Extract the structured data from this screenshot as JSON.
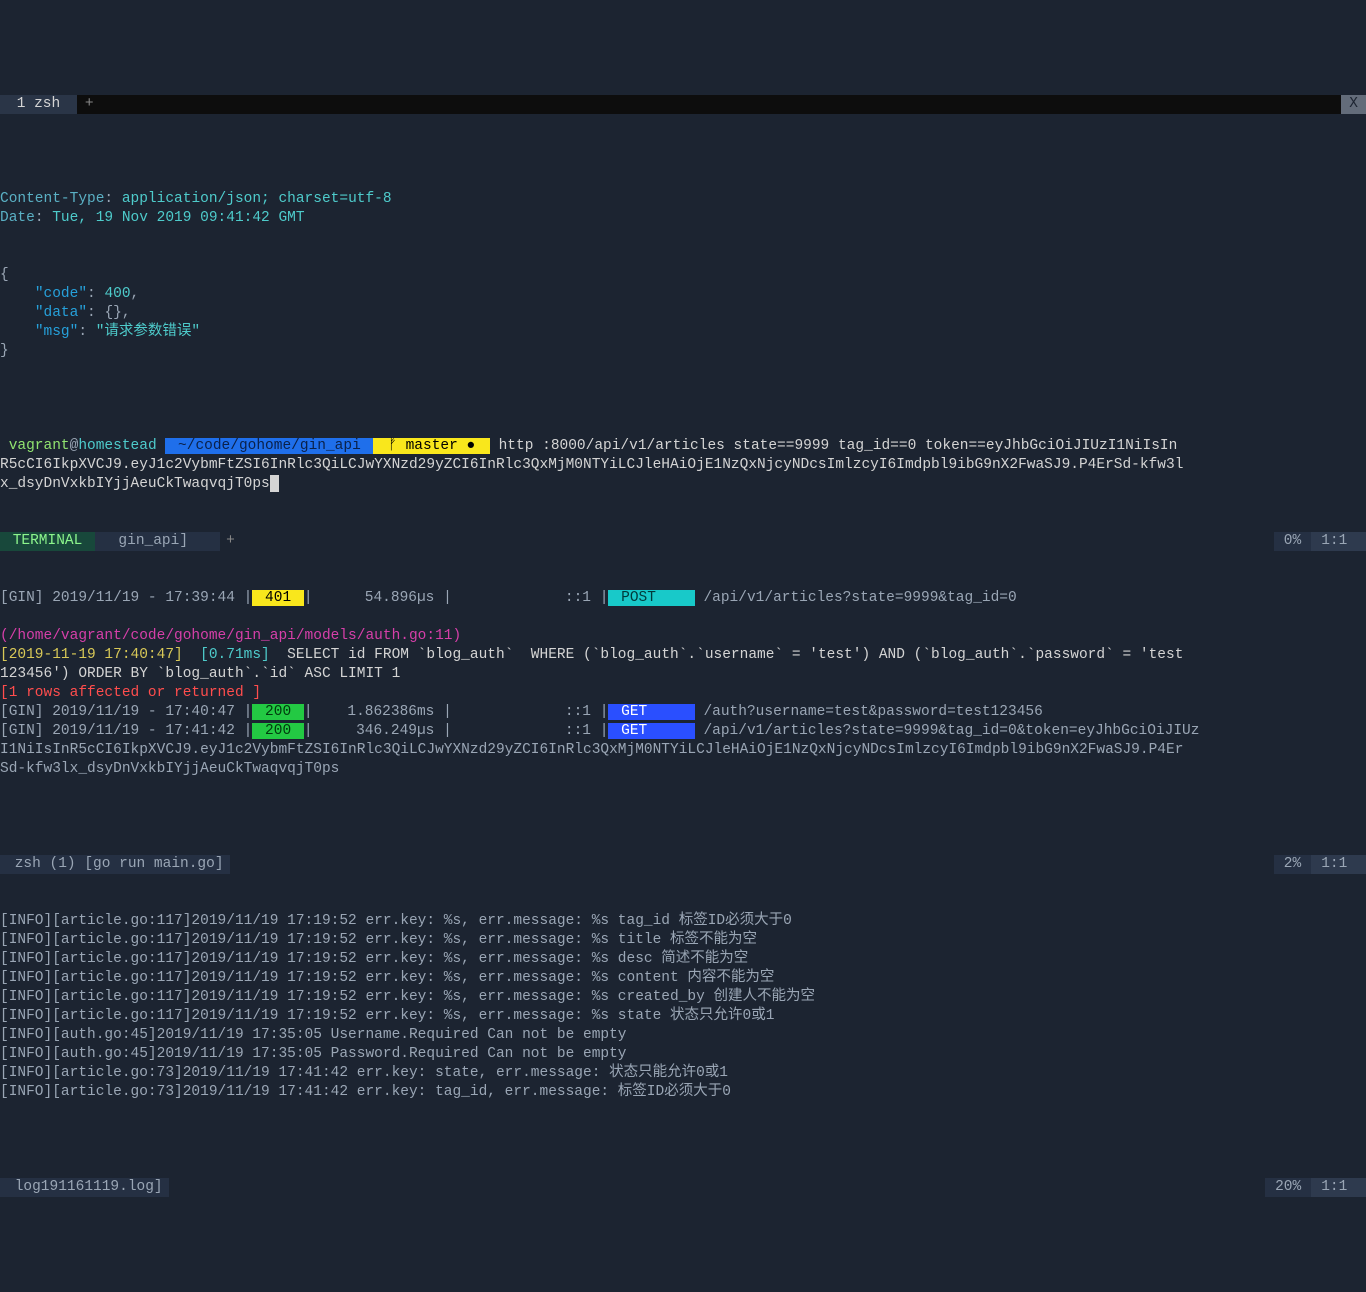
{
  "tabbar": {
    "tab1": " 1 zsh ",
    "plus": "+",
    "close": "X"
  },
  "response": {
    "h1_key": "Content-Type",
    "h1_val": "application/json; charset=utf-8",
    "h2_key": "Date",
    "h2_val": "Tue, 19 Nov 2019 09:41:42 GMT",
    "body_open": "{",
    "k_code": "\"code\"",
    "v_code": "400",
    "comma": ",",
    "k_data": "\"data\"",
    "v_data": "{}",
    "k_msg": "\"msg\"",
    "v_msg": "\"请求参数错误\"",
    "body_close": "}"
  },
  "prompt": {
    "user": " vagrant",
    "at": "@",
    "host": "homestead ",
    "path": " ~/code/gohome/gin_api ",
    "branch": " ᚠ master ● ",
    "cmd_line1": " http :8000/api/v1/articles state==9999 tag_id==0 token==eyJhbGciOiJIUzI1NiIsIn",
    "cmd_line2": "R5cCI6IkpXVCJ9.eyJ1c2VybmFtZSI6InRlc3QiLCJwYXNzd29yZCI6InRlc3QxMjM0NTYiLCJleHAiOjE1NzQxNjcyNDcsImlzcyI6Imdpbl9ibG9nX2FwaSJ9.P4ErSd-kfw3l",
    "cmd_line3": "x_dsyDnVxkbIYjjAeuCkTwaqvqjT0ps"
  },
  "pane_term": {
    "label": " TERMINAL ",
    "ident": "  gin_api]   ",
    "plus": "+",
    "pct": "0%",
    "pos": "1:1 "
  },
  "gin": {
    "l1_a": "[GIN] 2019/11/19 - 17:39:44 |",
    "l1_code": " 401 ",
    "l1_b": "|      54.896µs |             ::1 |",
    "l1_method": " POST    ",
    "l1_path": " /api/v1/articles?state=9999&tag_id=0",
    "path_magenta": "(/home/vagrant/code/gohome/gin_api/models/auth.go:11)",
    "ts": "[2019-11-19 17:40:47]",
    "ms": "  [0.71ms]",
    "sql": "  SELECT id FROM `blog_auth`  WHERE (`blog_auth`.`username` = 'test') AND (`blog_auth`.`password` = 'test",
    "sql2": "123456') ORDER BY `blog_auth`.`id` ASC LIMIT 1",
    "rows": "[1 rows affected or returned ]",
    "l2_a": "[GIN] 2019/11/19 - 17:40:47 |",
    "l2_code": " 200 ",
    "l2_b": "|    1.862386ms |             ::1 |",
    "l2_method": " GET     ",
    "l2_path": " /auth?username=test&password=test123456",
    "l3_a": "[GIN] 2019/11/19 - 17:41:42 |",
    "l3_code": " 200 ",
    "l3_b": "|     346.249µs |             ::1 |",
    "l3_method": " GET     ",
    "l3_path": " /api/v1/articles?state=9999&tag_id=0&token=eyJhbGciOiJIUz",
    "l3_wrap1": "I1NiIsInR5cCI6IkpXVCJ9.eyJ1c2VybmFtZSI6InRlc3QiLCJwYXNzd29yZCI6InRlc3QxMjM0NTYiLCJleHAiOjE1NzQxNjcyNDcsImlzcyI6Imdpbl9ibG9nX2FwaSJ9.P4Er",
    "l3_wrap2": "Sd-kfw3lx_dsyDnVxkbIYjjAeuCkTwaqvqjT0ps"
  },
  "pane_zsh": {
    "label": " zsh (1) [go run main.go]",
    "pct": "2%",
    "pos": "1:1 "
  },
  "logs": [
    "[INFO][article.go:117]2019/11/19 17:19:52 err.key: %s, err.message: %s tag_id 标签ID必须大于0",
    "[INFO][article.go:117]2019/11/19 17:19:52 err.key: %s, err.message: %s title 标签不能为空",
    "[INFO][article.go:117]2019/11/19 17:19:52 err.key: %s, err.message: %s desc 简述不能为空",
    "[INFO][article.go:117]2019/11/19 17:19:52 err.key: %s, err.message: %s content 内容不能为空",
    "[INFO][article.go:117]2019/11/19 17:19:52 err.key: %s, err.message: %s created_by 创建人不能为空",
    "[INFO][article.go:117]2019/11/19 17:19:52 err.key: %s, err.message: %s state 状态只允许0或1",
    "[INFO][auth.go:45]2019/11/19 17:35:05 Username.Required Can not be empty",
    "[INFO][auth.go:45]2019/11/19 17:35:05 Password.Required Can not be empty",
    "[INFO][article.go:73]2019/11/19 17:41:42 err.key: state, err.message: 状态只能允许0或1",
    "[INFO][article.go:73]2019/11/19 17:41:42 err.key: tag_id, err.message: 标签ID必须大于0"
  ],
  "pane_log": {
    "label": " log191161119.log]",
    "pct": "20%",
    "pos": "1:1 "
  }
}
